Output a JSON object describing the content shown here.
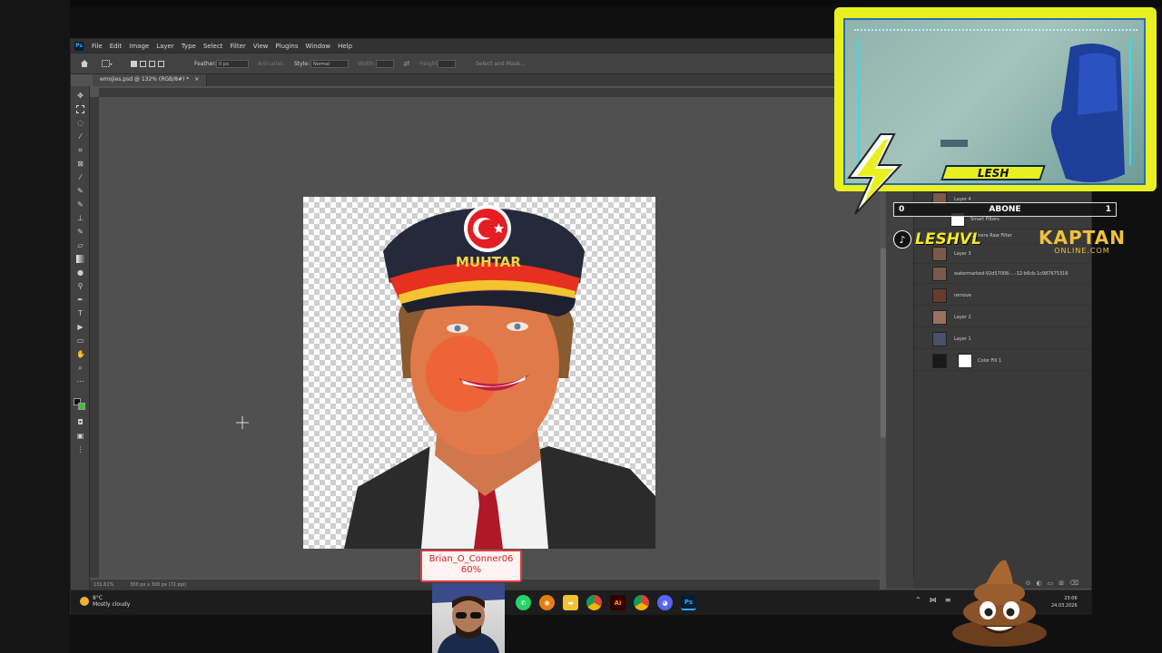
{
  "menubar": {
    "app_logo": "Ps",
    "items": [
      "File",
      "Edit",
      "Image",
      "Layer",
      "Type",
      "Select",
      "Filter",
      "View",
      "Plugins",
      "Window",
      "Help"
    ]
  },
  "options": {
    "feather_label": "Feather:",
    "feather_value": "0 px",
    "antialias_label": "Anti-alias",
    "style_label": "Style:",
    "style_value": "Normal",
    "width_label": "Width:",
    "height_label": "Height:",
    "select_mask": "Select and Mask..."
  },
  "document": {
    "tab_title": "emojies.psd @ 132% (RGB/8#) *",
    "hat_text": "MUHTAR"
  },
  "status": {
    "zoom": "131.61%",
    "doc_size": "300 px x 300 px (72 ppi)"
  },
  "layers": [
    {
      "name": "Layer 4"
    },
    {
      "name": "Smart Filters"
    },
    {
      "name": "Camera Raw Filter"
    },
    {
      "name": "Layer 3"
    },
    {
      "name": "watermarked-92d57006-...-12-b6cb-1c987675316"
    },
    {
      "name": "remove"
    },
    {
      "name": "Layer 2"
    },
    {
      "name": "Layer 1"
    },
    {
      "name": "Color Fill 1"
    }
  ],
  "taskbar": {
    "temperature": "8°C",
    "weather": "Mostly cloudy",
    "time": "23:06",
    "date": "24.03.2026"
  },
  "overlay": {
    "streamer_name": "LESH",
    "abone_left": "0",
    "abone_label": "ABONE",
    "abone_right": "1",
    "tiktok_name": "LESHVL",
    "brand_top": "KAPTAN",
    "brand_bottom": "ONLINE.COM",
    "donation_user": "Brian_O_Conner06",
    "donation_percent": "60%"
  },
  "colors": {
    "overlay_yellow": "#e8f020",
    "ps_blue": "#31a8ff",
    "donation_red": "#e23c3c"
  }
}
